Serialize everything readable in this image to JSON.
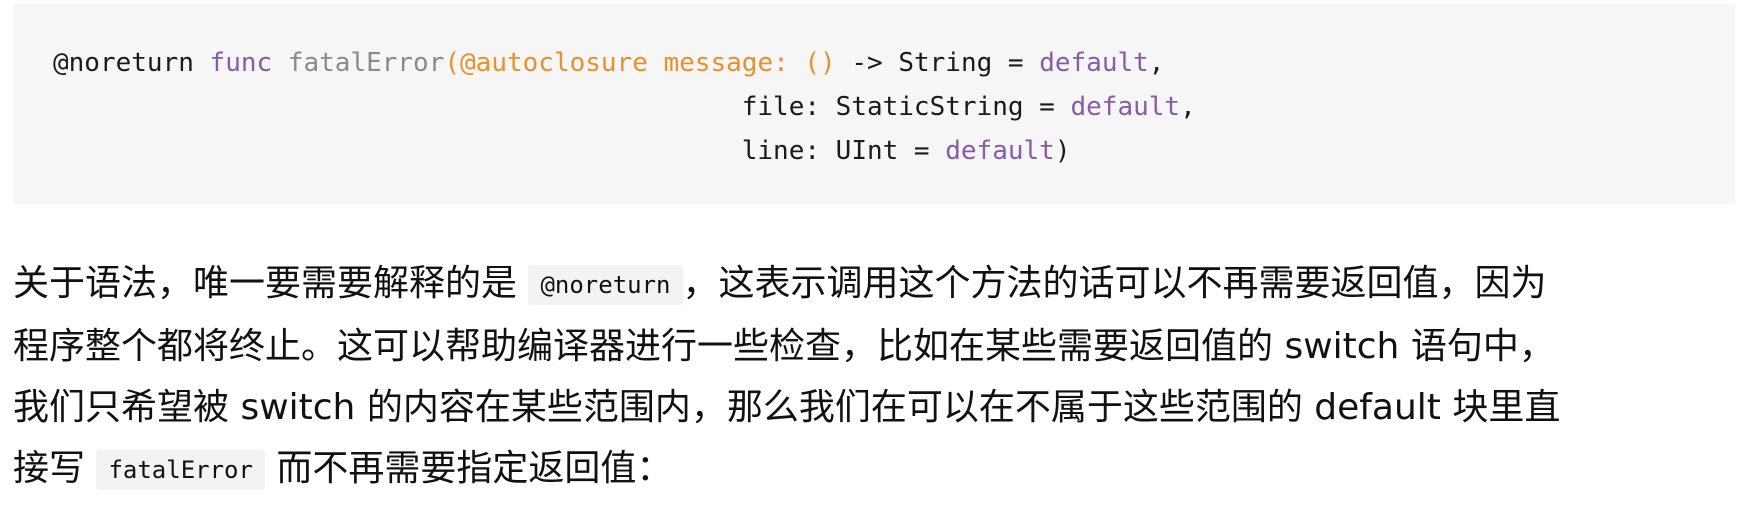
{
  "code": {
    "line1": {
      "attr": "@noreturn",
      "keyword": "func",
      "name": "fatalError",
      "params": "(@autoclosure message: ()",
      "arrow_type": " -> String = ",
      "default": "default",
      "trail": ","
    },
    "line2": {
      "text": "file: StaticString = ",
      "default": "default",
      "trail": ","
    },
    "line3": {
      "text": "line: UInt = ",
      "default": "default",
      "trail": ")"
    },
    "colors": {
      "keyword": "#8a5ba8",
      "function_name": "#8a8a8a",
      "parameter": "#e8912d",
      "background": "#f6f6f6"
    }
  },
  "paragraph": {
    "l1_a": "关于语法，唯一要需要解释的是 ",
    "l1_code": "@noreturn",
    "l1_b": "，这表示调用这个方法的话可以不再需要返回值，因为",
    "l2": "程序整个都将终止。这可以帮助编译器进行一些检查，比如在某些需要返回值的 switch 语句中，",
    "l3": "我们只希望被 switch 的内容在某些范围内，那么我们在可以在不属于这些范围的 default 块里直",
    "l4_a": "接写 ",
    "l4_code": "fatalError",
    "l4_b": " 而不再需要指定返回值："
  }
}
